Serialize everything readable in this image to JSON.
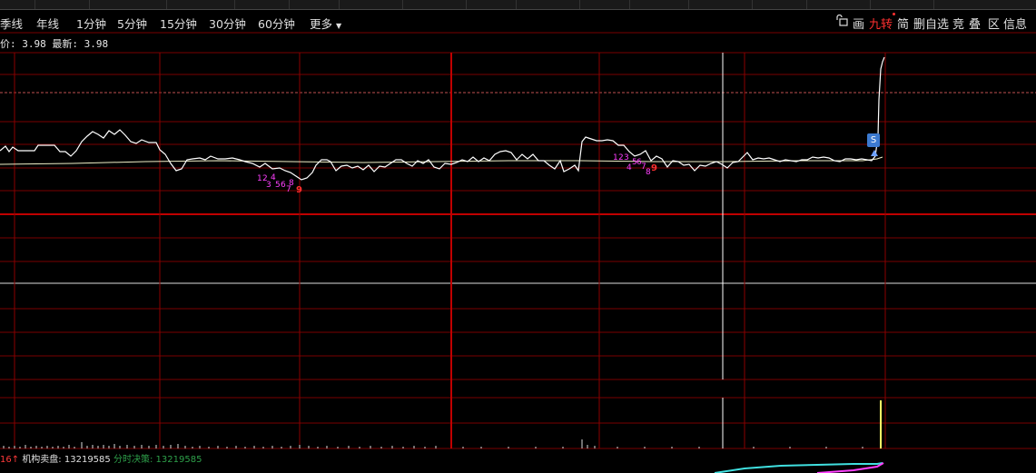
{
  "timeframes": [
    "季线",
    "年线",
    "1分钟",
    "5分钟",
    "15分钟",
    "30分钟",
    "60分钟",
    "更多"
  ],
  "right_tools": {
    "lock": "",
    "draw": "画",
    "jiuzhuan": "九转",
    "jian": "简",
    "remove_watch": "删自选",
    "jing": "竞",
    "die": "叠",
    "qu": "区",
    "info": "信息"
  },
  "price_info": {
    "label": "价:",
    "value": "3.98",
    "latest_label": "最新:",
    "latest_value": "3.98"
  },
  "signal": {
    "sell_marker": "S"
  },
  "td_sequence_1": [
    "1",
    "2",
    "4",
    "3",
    "5",
    "6",
    "8",
    "7",
    "9"
  ],
  "td_sequence_2": [
    "1",
    "2",
    "3",
    "4",
    "5",
    "6",
    "7",
    "8",
    "9"
  ],
  "status_bar": {
    "prefix": "16",
    "arrow": "↑",
    "inst_label": "机构卖盘:",
    "inst_value": "13219585",
    "fen_label": "分时决策:",
    "fen_value": "13219585"
  },
  "colors": {
    "grid": "#8b0000",
    "line": "#ffffff",
    "avg": "#ffff99",
    "magenta": "#ff40ff",
    "red": "#ff3030"
  }
}
